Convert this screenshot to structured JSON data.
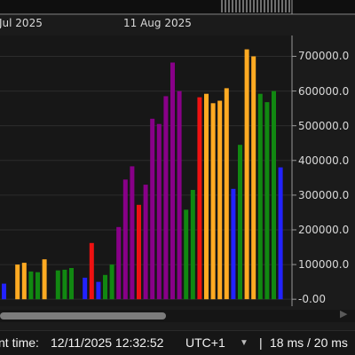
{
  "chart_data": {
    "type": "bar",
    "x_labels": [
      "Jul 2025",
      "11 Aug 2025"
    ],
    "ylim": [
      -20000,
      760000
    ],
    "yticks": [
      "700000.0",
      "600000.0",
      "500000.0",
      "400000.0",
      "300000.0",
      "200000.0",
      "100000.0",
      "-0.00"
    ],
    "ytick_values": [
      700000,
      600000,
      500000,
      400000,
      300000,
      200000,
      100000,
      0
    ],
    "values": [
      45000,
      0,
      100000,
      105000,
      80000,
      78000,
      115000,
      0,
      83000,
      85000,
      90000,
      0,
      62000,
      162000,
      50000,
      70000,
      100000,
      208000,
      345000,
      383000,
      272000,
      330000,
      520000,
      505000,
      585000,
      682000,
      600000,
      258000,
      315000,
      582000,
      592000,
      565000,
      572000,
      608000,
      318000,
      445000,
      720000,
      700000,
      592000,
      568000,
      600000,
      380000
    ],
    "colors": [
      "#2222ff",
      "#000000",
      "#ffaa22",
      "#ffaa22",
      "#118811",
      "#118811",
      "#ffaa22",
      "#000000",
      "#118811",
      "#118811",
      "#118811",
      "#000000",
      "#2222ff",
      "#ee1111",
      "#2222ff",
      "#118811",
      "#118811",
      "#880088",
      "#880088",
      "#880088",
      "#ee1111",
      "#880088",
      "#880088",
      "#880088",
      "#880088",
      "#880088",
      "#880088",
      "#118811",
      "#118811",
      "#ee1111",
      "#ffaa22",
      "#ffaa22",
      "#ffaa22",
      "#ffaa22",
      "#2222ff",
      "#118811",
      "#ffaa22",
      "#ffaa22",
      "#118811",
      "#118811",
      "#118811",
      "#2222ff"
    ]
  },
  "status_bar": {
    "time_label": "nt time:",
    "time_value": "12/11/2025 12:32:52",
    "timezone": "UTC+1",
    "dropdown_icon": "triangle-down",
    "separator": "|",
    "render_time": "18 ms / 20 ms"
  },
  "scroll_arrow_icon": "triangle-right",
  "colors": {
    "background": "#1b1b1b",
    "grid": "#2c2c2c",
    "axis": "#9a9a9a",
    "text": "#d8d8d8"
  }
}
